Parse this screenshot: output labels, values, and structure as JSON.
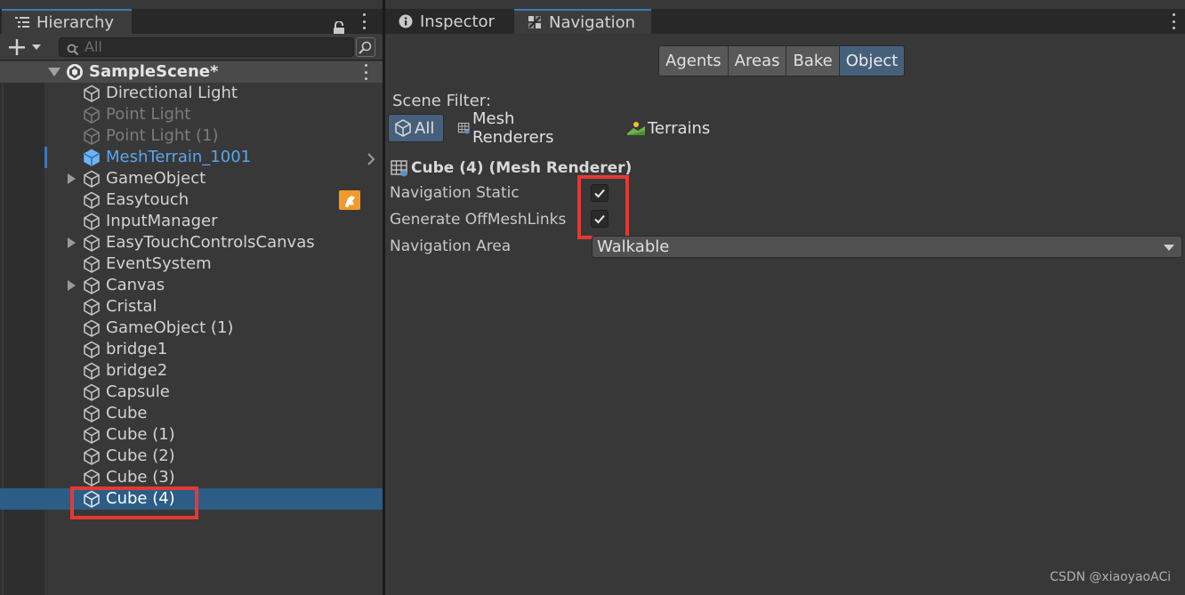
{
  "hierarchy": {
    "tab_label": "Hierarchy",
    "search_placeholder": "All",
    "scene_name": "SampleScene*",
    "items": [
      {
        "label": "Directional Light",
        "state": "normal",
        "expandable": false
      },
      {
        "label": "Point Light",
        "state": "disabled",
        "expandable": false
      },
      {
        "label": "Point Light (1)",
        "state": "disabled",
        "expandable": false
      },
      {
        "label": "MeshTerrain_1001",
        "state": "prefab",
        "expandable": false
      },
      {
        "label": "GameObject",
        "state": "normal",
        "expandable": true
      },
      {
        "label": "Easytouch",
        "state": "normal",
        "expandable": false
      },
      {
        "label": "InputManager",
        "state": "normal",
        "expandable": false
      },
      {
        "label": "EasyTouchControlsCanvas",
        "state": "normal",
        "expandable": true
      },
      {
        "label": "EventSystem",
        "state": "normal",
        "expandable": false
      },
      {
        "label": "Canvas",
        "state": "normal",
        "expandable": true
      },
      {
        "label": "Cristal",
        "state": "normal",
        "expandable": false
      },
      {
        "label": "GameObject (1)",
        "state": "normal",
        "expandable": false
      },
      {
        "label": "bridge1",
        "state": "normal",
        "expandable": false
      },
      {
        "label": "bridge2",
        "state": "normal",
        "expandable": false
      },
      {
        "label": "Capsule",
        "state": "normal",
        "expandable": false
      },
      {
        "label": "Cube",
        "state": "normal",
        "expandable": false
      },
      {
        "label": "Cube (1)",
        "state": "normal",
        "expandable": false
      },
      {
        "label": "Cube (2)",
        "state": "normal",
        "expandable": false
      },
      {
        "label": "Cube (3)",
        "state": "normal",
        "expandable": false
      },
      {
        "label": "Cube (4)",
        "state": "selected",
        "expandable": false
      }
    ]
  },
  "inspector": {
    "tabs": {
      "inspector": "Inspector",
      "navigation": "Navigation"
    },
    "segments": [
      "Agents",
      "Areas",
      "Bake",
      "Object"
    ],
    "active_segment": "Object",
    "scene_filter_label": "Scene Filter:",
    "filters": {
      "all": "All",
      "mesh_renderers": "Mesh Renderers",
      "terrains": "Terrains"
    },
    "object_title": "Cube (4) (Mesh Renderer)",
    "navigation_static_label": "Navigation Static",
    "navigation_static_checked": true,
    "generate_offmesh_label": "Generate OffMeshLinks",
    "generate_offmesh_checked": true,
    "navigation_area_label": "Navigation Area",
    "navigation_area_value": "Walkable"
  },
  "watermark": "CSDN @xiaoyaoACi",
  "colors": {
    "selection": "#2c5d87",
    "active_button": "#46607c",
    "prefab_text": "#59a6f1",
    "highlight_box": "#e53935"
  }
}
